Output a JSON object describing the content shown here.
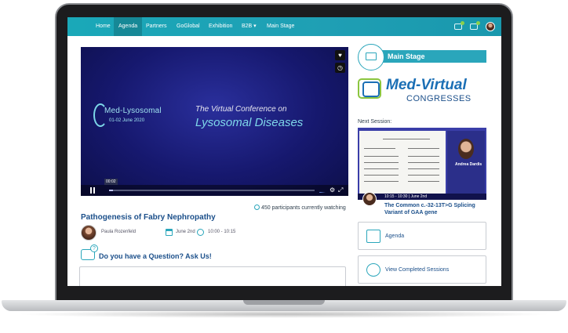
{
  "nav": {
    "items": [
      {
        "label": "Home"
      },
      {
        "label": "Agenda"
      },
      {
        "label": "Partners"
      },
      {
        "label": "GoGlobal"
      },
      {
        "label": "Exhibition"
      },
      {
        "label": "B2B ▾"
      },
      {
        "label": "Main Stage"
      }
    ],
    "active": "Agenda",
    "icons": [
      "mail-icon",
      "bell-icon",
      "user-avatar"
    ]
  },
  "video": {
    "logo_title": "Med-Lysosomal",
    "logo_date": "01-02 June 2020",
    "headline": "The Virtual Conference on",
    "headline_strong": "Lysosomal Diseases",
    "time_bubble": "00:02",
    "progress": 0.02,
    "side_buttons": [
      "heart-icon",
      "clock-icon"
    ]
  },
  "session": {
    "watching": "450 participants currently watching",
    "title": "Pathogenesis of Fabry Nephropathy",
    "speaker": "Paula Rozenfeld",
    "date": "June 2nd",
    "time": "10:00 - 10:15"
  },
  "question": {
    "title": "Do you have a Question? Ask Us!"
  },
  "sidebar": {
    "main_stage": "Main Stage",
    "logo_title": "Med-Virtual",
    "logo_sub": "CONGRESSES",
    "next_label": "Next Session:",
    "next_speaker": "Andrea Dardis",
    "next_time": "10:15 - 10:30 | June 2nd",
    "next_title": "The Common c.-32-13T>G Splicing Variant of GAA gene",
    "cards": [
      {
        "label": "Agenda"
      },
      {
        "label": "View Completed Sessions"
      }
    ]
  },
  "colors": {
    "accent": "#2aa6bb",
    "title_blue": "#1b4f8a",
    "nav_bg": "#1f9fb4"
  }
}
